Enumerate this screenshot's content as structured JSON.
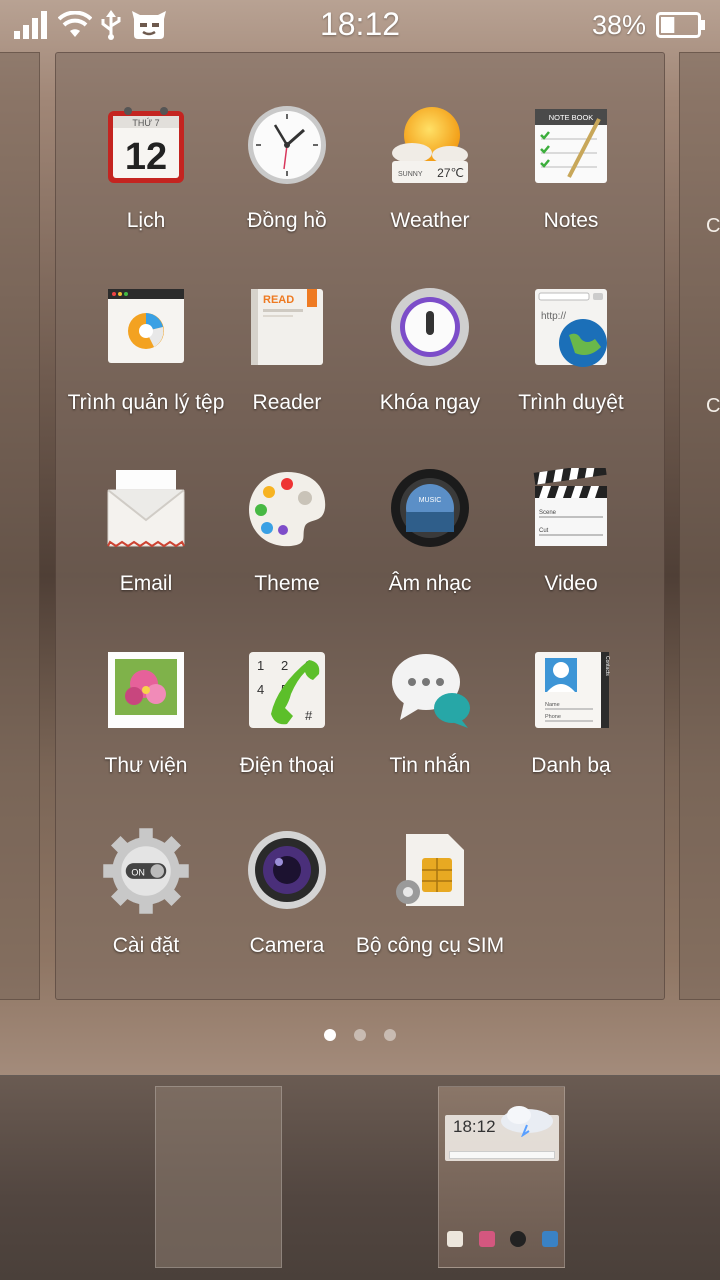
{
  "status_bar": {
    "time": "18:12",
    "battery_percent": "38%",
    "battery_level": 0.38,
    "icons": [
      "signal-icon",
      "wifi-icon",
      "usb-icon",
      "cyanogen-mascot-icon",
      "battery-icon"
    ]
  },
  "side_panel_right": {
    "letters": [
      "C",
      "C"
    ]
  },
  "apps": [
    {
      "label": "Lịch",
      "icon": "calendar-icon",
      "calendar_day": "12",
      "calendar_weekday": "THỨ 7"
    },
    {
      "label": "Đồng hồ",
      "icon": "clock-icon"
    },
    {
      "label": "Weather",
      "icon": "weather-icon",
      "weather_text": "SUNNY",
      "weather_temp": "27℃"
    },
    {
      "label": "Notes",
      "icon": "notes-icon",
      "notes_header": "NOTE BOOK"
    },
    {
      "label": "Trình quản lý tệp",
      "icon": "file-manager-icon"
    },
    {
      "label": "Reader",
      "icon": "reader-icon",
      "reader_text": "READ"
    },
    {
      "label": "Khóa ngay",
      "icon": "lock-icon"
    },
    {
      "label": "Trình duyệt",
      "icon": "browser-icon",
      "browser_text": "http://"
    },
    {
      "label": "Email",
      "icon": "email-icon"
    },
    {
      "label": "Theme",
      "icon": "theme-palette-icon"
    },
    {
      "label": "Âm nhạc",
      "icon": "music-icon",
      "music_text": "MUSIC"
    },
    {
      "label": "Video",
      "icon": "video-clapper-icon",
      "clapper_scene": "Scene",
      "clapper_cut": "Cut"
    },
    {
      "label": "Thư viện",
      "icon": "gallery-icon"
    },
    {
      "label": "Điện thoại",
      "icon": "phone-icon"
    },
    {
      "label": "Tin nhắn",
      "icon": "messages-icon"
    },
    {
      "label": "Danh bạ",
      "icon": "contacts-icon",
      "contacts_tab": "Contacts",
      "contacts_name": "Name",
      "contacts_phone": "Phone"
    },
    {
      "label": "Cài đặt",
      "icon": "settings-gear-icon",
      "settings_toggle": "ON"
    },
    {
      "label": "Camera",
      "icon": "camera-icon"
    },
    {
      "label": "Bộ công cụ SIM",
      "icon": "sim-toolkit-icon"
    }
  ],
  "page_indicator": {
    "count": 3,
    "active_index": 0
  },
  "dock": {
    "thumbnails": [
      {
        "name": "empty-screen"
      },
      {
        "name": "home-screen",
        "widget_time": "18:12"
      }
    ]
  },
  "colors": {
    "calendar_red": "#d52b26",
    "weather_sun": "#f7a51c",
    "lock_ring": "#7c4dc9",
    "phone_green": "#5cbf2a",
    "messages_teal": "#27a7a7",
    "dot_active": "#ffffff"
  }
}
